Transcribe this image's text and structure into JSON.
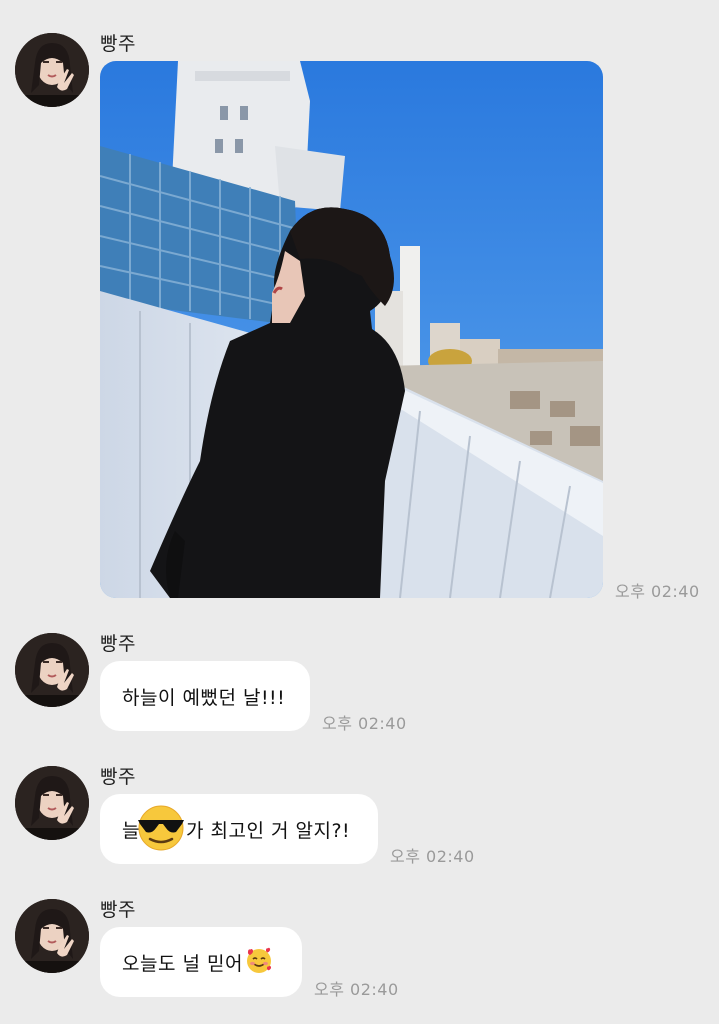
{
  "messages": [
    {
      "sender": "빵주",
      "type": "photo",
      "time": "오후 02:40"
    },
    {
      "sender": "빵주",
      "type": "text",
      "text": "하늘이 예뻤던 날!!!",
      "time": "오후 02:40"
    },
    {
      "sender": "빵주",
      "type": "text",
      "text_before": "늘",
      "emoji": "sunglasses-emoji",
      "text_after": "가 최고인 거 알지?!",
      "time": "오후 02:40"
    },
    {
      "sender": "빵주",
      "type": "text",
      "text": "오늘도 널 믿어",
      "emoji": "smiling-face-with-hearts-emoji",
      "time": "오후 02:40"
    }
  ],
  "colors": {
    "background": "#ebebeb",
    "bubble": "#ffffff",
    "timestamp": "#9a9a9a",
    "sky": "#2f7fe0"
  }
}
